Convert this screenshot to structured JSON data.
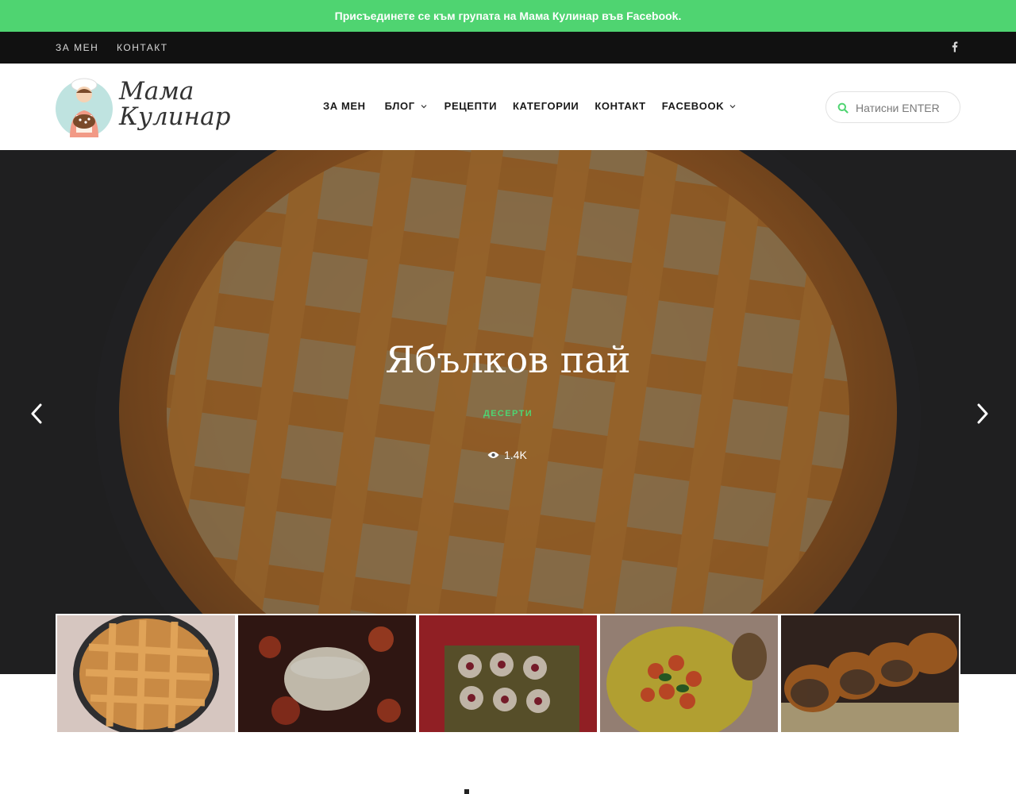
{
  "promo": {
    "text": "Присъединете се към групата на Мама Кулинар във Facebook."
  },
  "topbar": {
    "links": [
      "ЗА МЕН",
      "КОНТАКТ"
    ],
    "social_icon": "facebook-icon"
  },
  "header": {
    "logo": {
      "line1": "Мама",
      "line2": "Кулинар"
    },
    "nav": [
      {
        "label": "ЗА МЕН",
        "has_dropdown": false
      },
      {
        "label": "БЛОГ",
        "has_dropdown": true
      },
      {
        "label": "РЕЦЕПТИ",
        "has_dropdown": false
      },
      {
        "label": "КАТЕГОРИИ",
        "has_dropdown": false
      },
      {
        "label": "КОНТАКТ",
        "has_dropdown": false
      },
      {
        "label": "FACEBOOK",
        "has_dropdown": true
      }
    ],
    "search": {
      "placeholder": "Натисни ENTER",
      "value": "",
      "icon": "search-icon"
    }
  },
  "slider": {
    "title": "Ябълков пай",
    "category": "ДЕСЕРТИ",
    "views": "1.4K",
    "prev_icon": "chevron-left-icon",
    "next_icon": "chevron-right-icon",
    "thumbnails": [
      {
        "subject": "apple-pie",
        "active": true
      },
      {
        "subject": "baked-cheese",
        "active": false
      },
      {
        "subject": "jam-cookies",
        "active": false
      },
      {
        "subject": "shrimp-plate",
        "active": false
      },
      {
        "subject": "braided-bread",
        "active": false
      }
    ]
  },
  "colors": {
    "promo_bg": "#4fd471",
    "accent": "#4fd471",
    "topbar_bg": "#111111",
    "text_dark": "#1a1a1a"
  }
}
